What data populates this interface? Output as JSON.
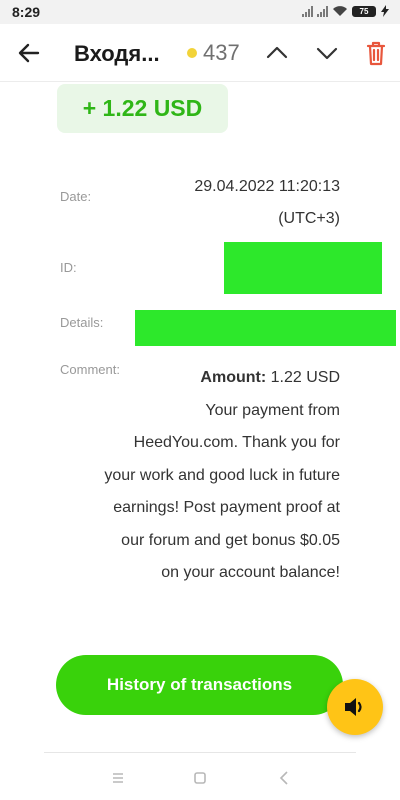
{
  "status_bar": {
    "time": "8:29",
    "battery": "75"
  },
  "header": {
    "title": "Входя...",
    "unread_count": "437"
  },
  "transaction": {
    "amount": "+ 1.22 USD",
    "date_label": "Date:",
    "date_value": "29.04.2022 11:20:13",
    "timezone": "(UTC+3)",
    "id_label": "ID:",
    "details_label": "Details:",
    "comment_label": "Comment:",
    "amount_label": "Amount:",
    "amount_value": " 1.22 USD",
    "comment_text": "Your payment from HeedYou.com. Thank you for your work and good luck in future earnings! Post payment proof at our forum and get bonus $0.05 on your account balance!"
  },
  "buttons": {
    "history": "History of transactions"
  },
  "colors": {
    "accent_green": "#39d20b",
    "amount_green": "#2fb617",
    "delete_red": "#e8563c",
    "sound_yellow": "#ffc416",
    "redaction": "#2de82b"
  },
  "icons": [
    "back-arrow-icon",
    "unread-dot-icon",
    "chevron-up-icon",
    "chevron-down-icon",
    "trash-icon",
    "speaker-icon",
    "menu-icon",
    "home-square-icon",
    "back-triangle-icon"
  ]
}
